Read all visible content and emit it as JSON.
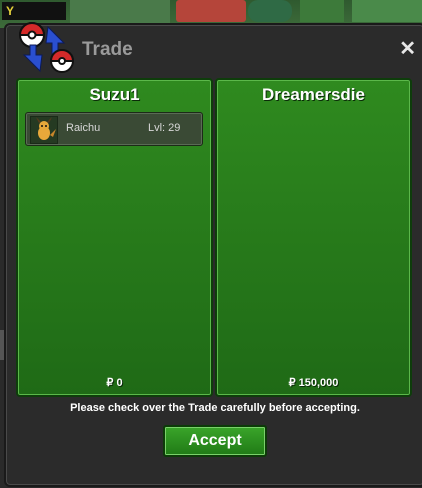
{
  "background": {
    "label": "Y"
  },
  "window": {
    "title": "Trade",
    "close_symbol": "✕"
  },
  "panels": {
    "left": {
      "name": "Suzu1",
      "money": "₽ 0",
      "items": [
        {
          "name": "Raichu",
          "level": "Lvl: 29"
        }
      ]
    },
    "right": {
      "name": "Dreamersdie",
      "money": "₽ 150,000"
    }
  },
  "notice": "Please check over the Trade carefully before accepting.",
  "accept_label": "Accept",
  "colors": {
    "panel_green": "#2f8a1f",
    "window_bg": "#2b2b2b",
    "accept_green": "#3aa52a"
  }
}
